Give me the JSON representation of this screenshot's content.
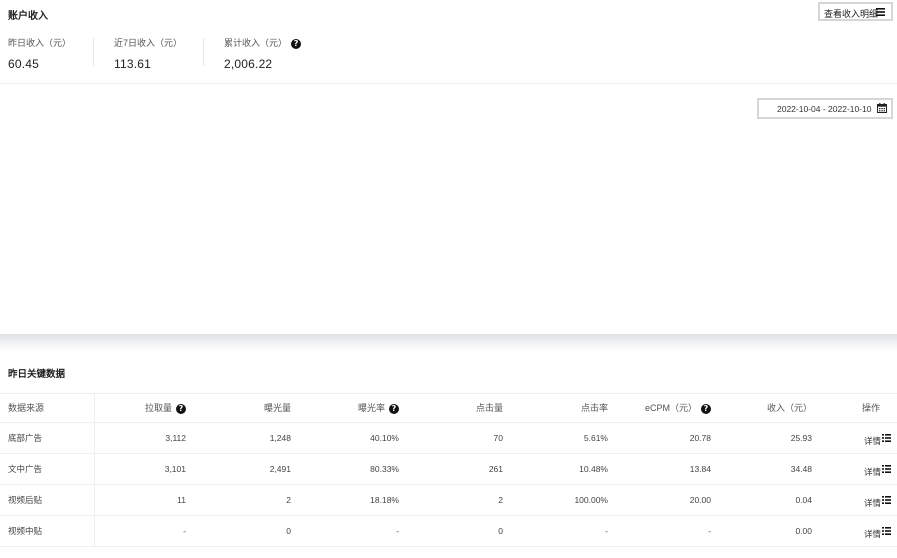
{
  "account": {
    "title": "账户收入",
    "detail_button": "查看收入明细",
    "stats": [
      {
        "label": "昨日收入（元）",
        "value": "60.45"
      },
      {
        "label": "近7日收入（元）",
        "value": "113.61"
      },
      {
        "label": "累计收入（元）",
        "value": "2,006.22"
      }
    ]
  },
  "date_range": "2022-10-04 - 2022-10-10",
  "key_data": {
    "title": "昨日关键数据",
    "columns": [
      "数据来源",
      "拉取量",
      "曝光量",
      "曝光率",
      "点击量",
      "点击率",
      "eCPM（元）",
      "收入（元）",
      "操作"
    ],
    "rows": [
      {
        "source": "底部广告",
        "pull": "3,112",
        "impressions": "1,248",
        "impression_rate": "40.10%",
        "clicks": "70",
        "ctr": "5.61%",
        "ecpm": "20.78",
        "revenue": "25.93",
        "action": "详情"
      },
      {
        "source": "文中广告",
        "pull": "3,101",
        "impressions": "2,491",
        "impression_rate": "80.33%",
        "clicks": "261",
        "ctr": "10.48%",
        "ecpm": "13.84",
        "revenue": "34.48",
        "action": "详情"
      },
      {
        "source": "视频后贴",
        "pull": "11",
        "impressions": "2",
        "impression_rate": "18.18%",
        "clicks": "2",
        "ctr": "100.00%",
        "ecpm": "20.00",
        "revenue": "0.04",
        "action": "详情"
      },
      {
        "source": "视频中贴",
        "pull": "-",
        "impressions": "0",
        "impression_rate": "-",
        "clicks": "0",
        "ctr": "-",
        "ecpm": "-",
        "revenue": "0.00",
        "action": "详情"
      }
    ]
  },
  "icons": {
    "help": "question-circle-icon",
    "list": "list-icon",
    "calendar": "calendar-icon"
  },
  "colors": {
    "text": "#333333",
    "border": "#d6d6d6",
    "divider": "#eeeeee"
  }
}
